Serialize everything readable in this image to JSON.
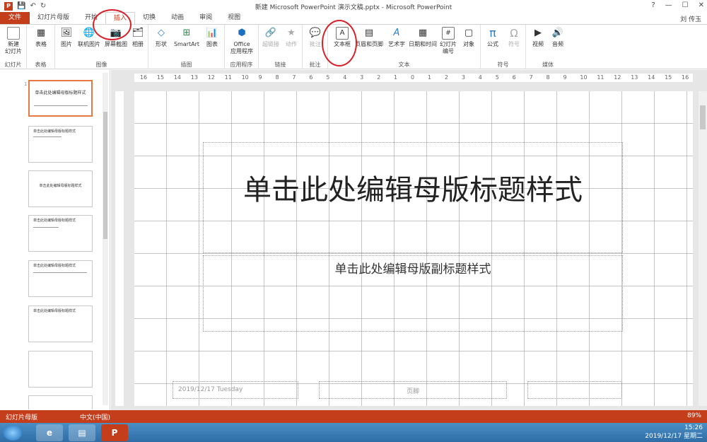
{
  "window": {
    "title": "新建 Microsoft PowerPoint 演示文稿.pptx - Microsoft PowerPoint",
    "user": "刘 传玉",
    "controls": [
      "?",
      "—",
      "☐",
      "✕"
    ]
  },
  "qat": {
    "icon": "P",
    "save": "💾",
    "undo": "↶",
    "redo": "↻"
  },
  "tabs": [
    "文件",
    "幻灯片母版",
    "开始",
    "插入",
    "切换",
    "动画",
    "审阅",
    "视图"
  ],
  "ribbon": {
    "groups": [
      {
        "label": "幻灯片",
        "buttons": [
          {
            "label": "新建\n幻灯片",
            "icon": "new-slide-icon",
            "glyph": "▭"
          }
        ]
      },
      {
        "label": "表格",
        "buttons": [
          {
            "label": "表格",
            "icon": "table-icon",
            "glyph": "▦"
          }
        ]
      },
      {
        "label": "图像",
        "buttons": [
          {
            "label": "图片",
            "icon": "picture-icon",
            "glyph": "🖼"
          },
          {
            "label": "联机图片",
            "icon": "online-picture-icon",
            "glyph": "🌐"
          },
          {
            "label": "屏幕截图",
            "icon": "screenshot-icon",
            "glyph": "📷"
          },
          {
            "label": "相册",
            "icon": "album-icon",
            "glyph": "🗂"
          }
        ]
      },
      {
        "label": "插图",
        "buttons": [
          {
            "label": "形状",
            "icon": "shapes-icon",
            "glyph": "◇"
          },
          {
            "label": "SmartArt",
            "icon": "smartart-icon",
            "glyph": "⊞"
          },
          {
            "label": "图表",
            "icon": "chart-icon",
            "glyph": "📊"
          }
        ]
      },
      {
        "label": "应用程序",
        "buttons": [
          {
            "label": "Office\n应用程序",
            "icon": "office-apps-icon",
            "glyph": "⬢"
          }
        ]
      },
      {
        "label": "链接",
        "buttons": [
          {
            "label": "超链接",
            "icon": "hyperlink-icon",
            "glyph": "🔗"
          },
          {
            "label": "动作",
            "icon": "action-icon",
            "glyph": "★"
          }
        ]
      },
      {
        "label": "批注",
        "buttons": [
          {
            "label": "批注",
            "icon": "comment-icon",
            "glyph": "💬"
          }
        ]
      },
      {
        "label": "文本",
        "buttons": [
          {
            "label": "文本框",
            "icon": "textbox-icon",
            "glyph": "A"
          },
          {
            "label": "页眉和页脚",
            "icon": "header-footer-icon",
            "glyph": "▤"
          },
          {
            "label": "艺术字",
            "icon": "wordart-icon",
            "glyph": "A"
          },
          {
            "label": "日期和时间",
            "icon": "datetime-icon",
            "glyph": "▦"
          },
          {
            "label": "幻灯片\n编号",
            "icon": "slide-number-icon",
            "glyph": "#"
          },
          {
            "label": "对象",
            "icon": "object-icon",
            "glyph": "▢"
          }
        ]
      },
      {
        "label": "符号",
        "buttons": [
          {
            "label": "公式",
            "icon": "equation-icon",
            "glyph": "π"
          },
          {
            "label": "符号",
            "icon": "symbol-icon",
            "glyph": "Ω"
          }
        ]
      },
      {
        "label": "媒体",
        "buttons": [
          {
            "label": "视频",
            "icon": "video-icon",
            "glyph": "▶"
          },
          {
            "label": "音频",
            "icon": "audio-icon",
            "glyph": "🔊"
          }
        ]
      }
    ]
  },
  "ruler": {
    "ticks": [
      "16",
      "15",
      "14",
      "13",
      "12",
      "11",
      "10",
      "9",
      "8",
      "7",
      "6",
      "5",
      "4",
      "3",
      "2",
      "1",
      "0",
      "1",
      "2",
      "3",
      "4",
      "5",
      "6",
      "7",
      "8",
      "9",
      "10",
      "11",
      "12",
      "13",
      "14",
      "15",
      "16"
    ]
  },
  "thumbnails": [
    {
      "num": "1",
      "title": "单击此处编辑母版标题样式"
    },
    {
      "num": "",
      "title": "单击此处编辑母版标题样式"
    },
    {
      "num": "",
      "title": "单击此处编辑母版标题样式"
    },
    {
      "num": "",
      "title": "单击此处编辑母版标题样式"
    },
    {
      "num": "",
      "title": "单击此处编辑母版标题样式"
    },
    {
      "num": "",
      "title": "单击此处编辑母版标题样式"
    },
    {
      "num": "",
      "title": ""
    },
    {
      "num": "",
      "title": ""
    }
  ],
  "slide": {
    "title": "单击此处编辑母版标题样式",
    "subtitle": "单击此处编辑母版副标题样式",
    "date": "2019/12/17 Tuesday",
    "footer": "页脚"
  },
  "statusbar": {
    "left": "幻灯片母版",
    "lang": "中文(中国)",
    "zoom": "89%"
  },
  "taskbar": {
    "time": "15:26",
    "date": "2019/12/17 星期二"
  },
  "colors": {
    "accent": "#c43e1c",
    "annotation": "#d9212a"
  }
}
